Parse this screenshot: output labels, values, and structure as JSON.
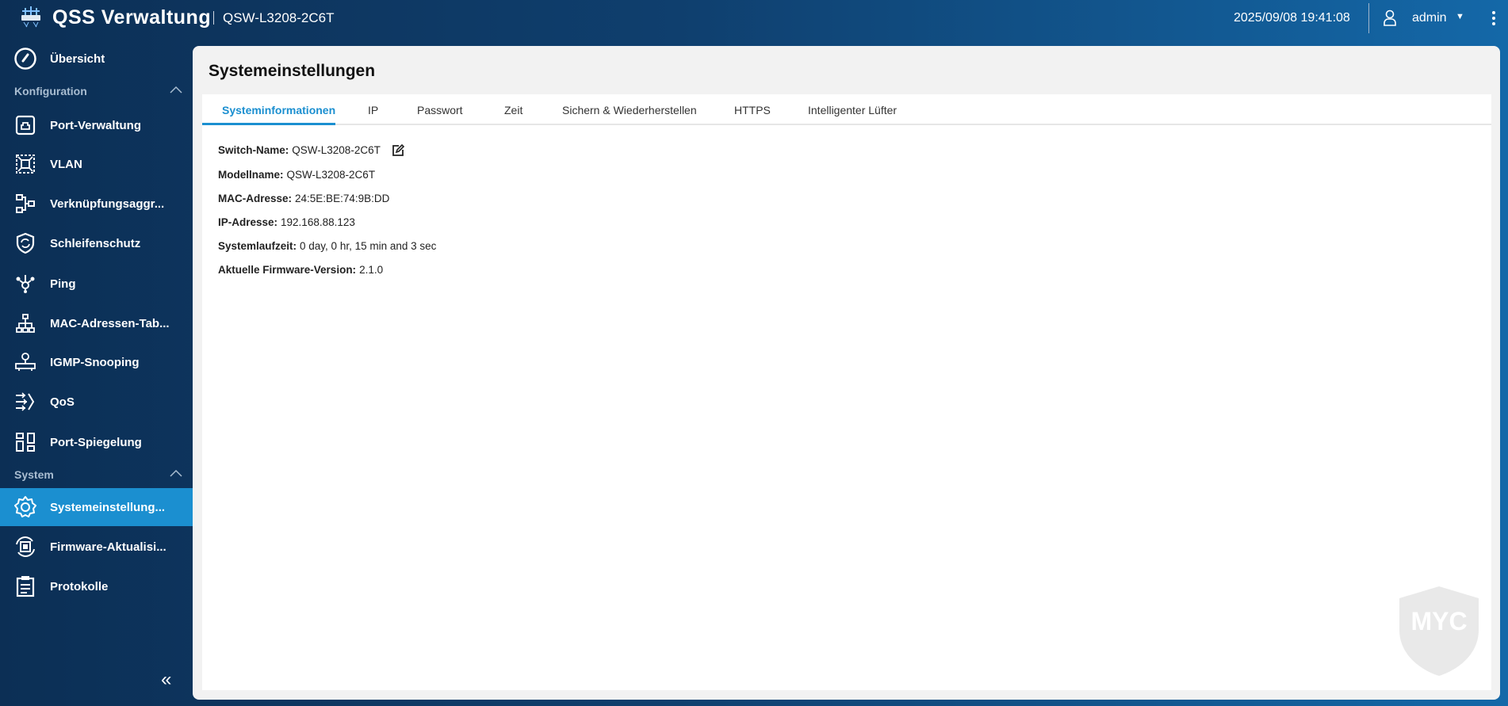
{
  "header": {
    "app_title": "QSS  Verwaltung",
    "model": "QSW-L3208-2C6T",
    "datetime": "2025/09/08  19:41:08",
    "user": "admin"
  },
  "sidebar": {
    "overview": {
      "label": "Übersicht",
      "icon": "gauge-icon"
    },
    "sections": [
      {
        "label": "Konfiguration"
      },
      {
        "label": "System"
      }
    ],
    "config_items": [
      {
        "label": "Port-Verwaltung",
        "icon": "port-icon"
      },
      {
        "label": "VLAN",
        "icon": "vlan-icon"
      },
      {
        "label": "Verknüpfungsaggr...",
        "icon": "link-aggregation-icon"
      },
      {
        "label": "Schleifenschutz",
        "icon": "shield-icon"
      },
      {
        "label": "Ping",
        "icon": "ping-icon"
      },
      {
        "label": "MAC-Adressen-Tab...",
        "icon": "hierarchy-icon"
      },
      {
        "label": "IGMP-Snooping",
        "icon": "igmp-icon"
      },
      {
        "label": "QoS",
        "icon": "qos-icon"
      },
      {
        "label": "Port-Spiegelung",
        "icon": "mirror-icon"
      }
    ],
    "system_items": [
      {
        "label": "Systemeinstellung...",
        "icon": "gear-icon",
        "active": true
      },
      {
        "label": "Firmware-Aktualisi...",
        "icon": "firmware-icon"
      },
      {
        "label": "Protokolle",
        "icon": "log-icon"
      }
    ]
  },
  "main": {
    "title": "Systemeinstellungen",
    "tabs": [
      {
        "label": "Systeminformationen",
        "active": true
      },
      {
        "label": "IP"
      },
      {
        "label": "Passwort"
      },
      {
        "label": "Zeit"
      },
      {
        "label": "Sichern & Wiederherstellen"
      },
      {
        "label": "HTTPS"
      },
      {
        "label": "Intelligenter Lüfter"
      }
    ],
    "info": [
      {
        "label": "Switch-Name:",
        "value": "QSW-L3208-2C6T"
      },
      {
        "label": "Modellname:",
        "value": "QSW-L3208-2C6T"
      },
      {
        "label": "MAC-Adresse:",
        "value": "24:5E:BE:74:9B:DD"
      },
      {
        "label": "IP-Adresse:",
        "value": "192.168.88.123"
      },
      {
        "label": "Systemlaufzeit:",
        "value": "0 day, 0 hr, 15 min and 3 sec"
      },
      {
        "label": "Aktuelle Firmware-Version:",
        "value": "2.1.0"
      }
    ]
  },
  "watermark": "MYC",
  "colors": {
    "accent": "#1b8fd0",
    "header_dark": "#0c2f55",
    "header_light": "#1468a8"
  }
}
